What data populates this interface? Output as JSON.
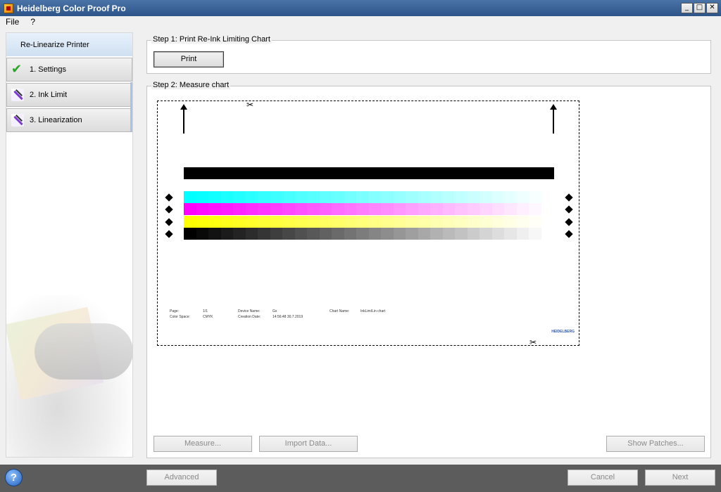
{
  "window": {
    "title": "Heidelberg Color Proof Pro",
    "minimize": "_",
    "maximize": "□",
    "close": "✕"
  },
  "menu": {
    "items": [
      "File",
      "?"
    ]
  },
  "sidebar": {
    "header": "Re-Linearize Printer",
    "items": [
      {
        "label": "1. Settings",
        "icon": "check-icon",
        "status": "done"
      },
      {
        "label": "2. Ink Limit",
        "icon": "pencil-icon"
      },
      {
        "label": "3. Linearization",
        "icon": "pencil-icon"
      }
    ]
  },
  "step1": {
    "title": "Step 1: Print Re-Ink Limiting Chart",
    "print_label": "Print"
  },
  "step2": {
    "title": "Step 2: Measure chart",
    "measure_label": "Measure...",
    "import_label": "Import Data...",
    "show_patches_label": "Show Patches...",
    "chart_info": {
      "page_label": "Page:",
      "page_value": "1/1",
      "color_space_label": "Color Space:",
      "color_space_value": "CMYK",
      "device_name_label": "Device Name:",
      "device_name_value": "Gx",
      "creation_date_label": "Creation Date:",
      "creation_date_value": "14:56:48 30.7.2019",
      "chart_name_label": "Chart Name:",
      "chart_name_value": "InkLim/Lin chart",
      "logo": "HEIDELBERG"
    },
    "colors": {
      "cyan": "#00ffff",
      "magenta": "#ff00ff",
      "yellow": "#ffff00",
      "black": "#000000"
    }
  },
  "footer": {
    "advanced_label": "Advanced",
    "cancel_label": "Cancel",
    "next_label": "Next",
    "help": "?"
  }
}
